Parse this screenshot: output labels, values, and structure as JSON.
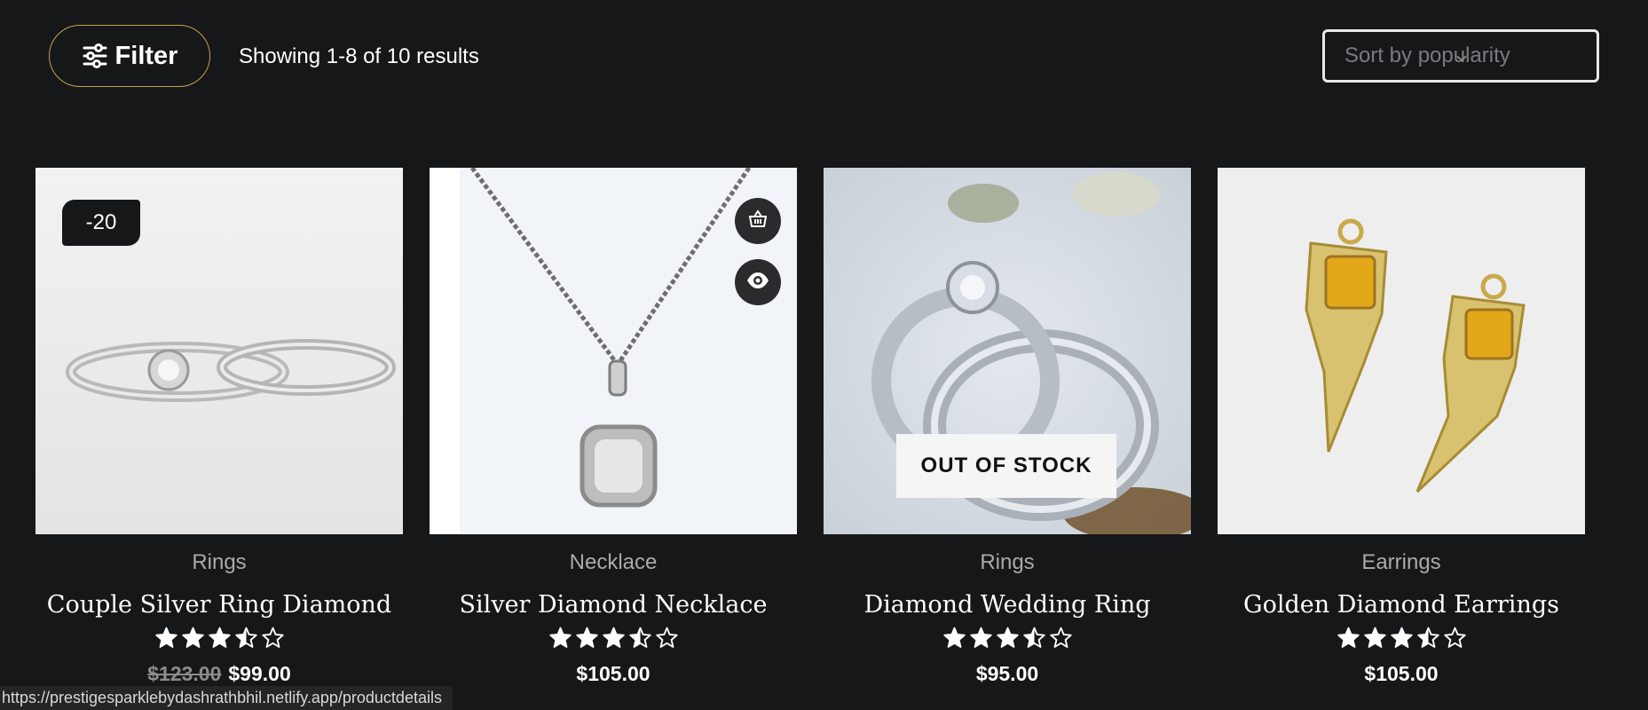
{
  "toolbar": {
    "filter_label": "Filter",
    "results_text": "Showing 1-8 of 10 results",
    "sort_value": "Sort by popularity"
  },
  "colors": {
    "background": "#161719",
    "filter_border": "#c9a34f",
    "text": "#ffffff",
    "muted": "#a9aaac"
  },
  "products": [
    {
      "category": "Rings",
      "name": "Couple Silver Ring Diamond",
      "badge": "-20",
      "old_price": "$123.00",
      "price": "$99.00",
      "rating": 3.5
    },
    {
      "category": "Necklace",
      "name": "Silver Diamond Necklace",
      "price": "$105.00",
      "rating": 3.5,
      "actions": [
        "basket-icon",
        "eye-icon"
      ]
    },
    {
      "category": "Rings",
      "name": "Diamond Wedding Ring",
      "overlay": "OUT OF STOCK",
      "price": "$95.00",
      "rating": 3.5
    },
    {
      "category": "Earrings",
      "name": "Golden Diamond Earrings",
      "price": "$105.00",
      "rating": 3.5
    }
  ],
  "status_url": "https://prestigesparklebydashrathbhil.netlify.app/productdetails"
}
